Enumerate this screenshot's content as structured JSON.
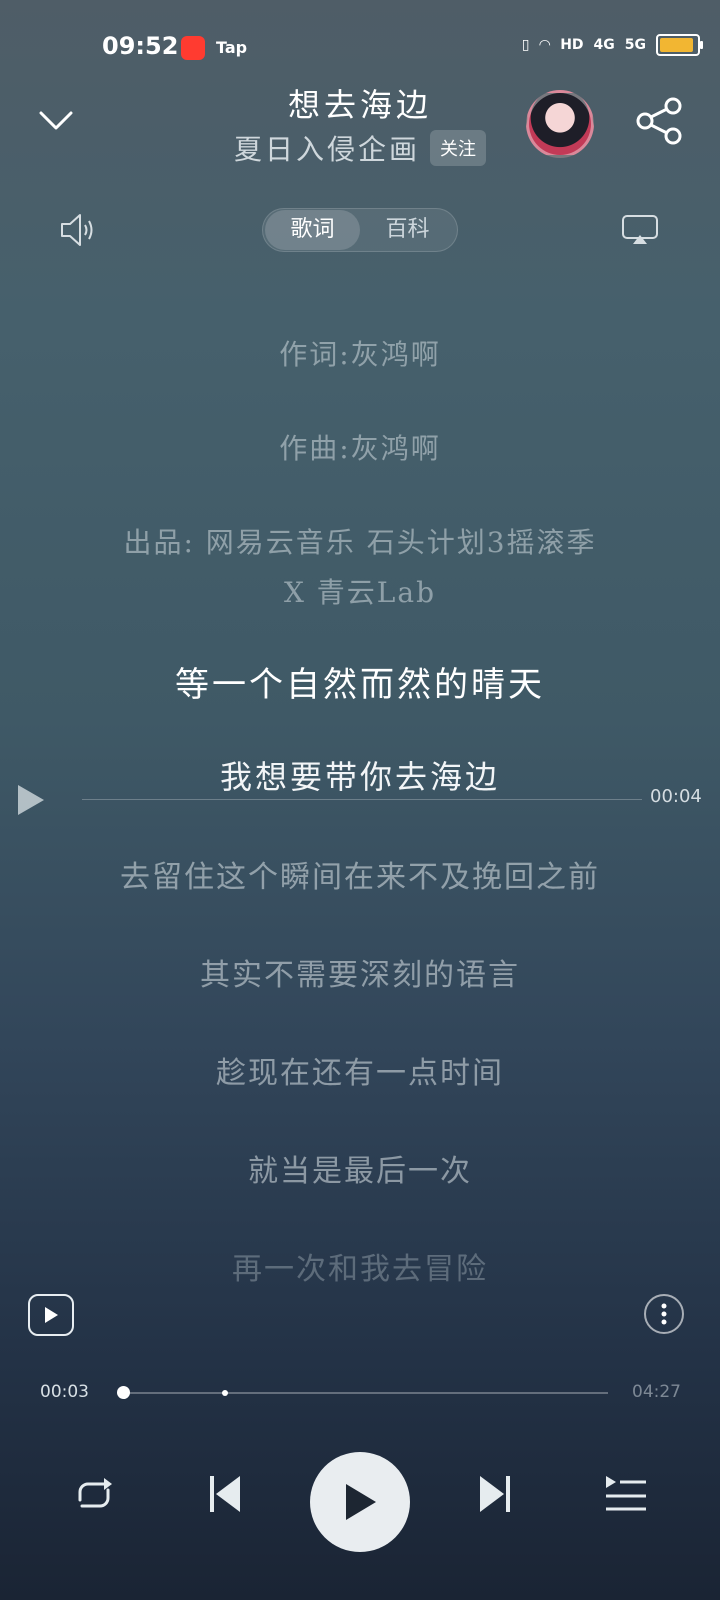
{
  "status_bar": {
    "time": "09:52",
    "app_label": "Tap",
    "network_labels": [
      "HD",
      "4G",
      "5G"
    ]
  },
  "header": {
    "title": "想去海边",
    "artist": "夏日入侵企画",
    "follow_label": "关注"
  },
  "tabs": [
    {
      "label": "歌词",
      "active": true
    },
    {
      "label": "百科",
      "active": false
    }
  ],
  "lyrics": {
    "credits": [
      "作词:灰鸿啊",
      "作曲:灰鸿啊",
      "出品: 网易云音乐 石头计划3摇滚季",
      "X 青云Lab"
    ],
    "current_line": "等一个自然而然的晴天",
    "seek_line": "我想要带你去海边",
    "upcoming": [
      "去留住这个瞬间在来不及挽回之前",
      "其实不需要深刻的语言",
      "趁现在还有一点时间",
      "就当是最后一次"
    ],
    "faded_line": "再一次和我去冒险",
    "seek_time": "00:04"
  },
  "progress": {
    "current": "00:03",
    "total": "04:27",
    "fraction": 0.012
  },
  "icons": {
    "collapse": "chevron-down-icon",
    "share": "share-icon",
    "volume": "volume-icon",
    "airplay": "airplay-icon",
    "repeat": "repeat-icon",
    "previous": "previous-icon",
    "play": "play-icon",
    "next": "next-icon",
    "playlist": "playlist-icon"
  },
  "colors": {
    "accent": "#ffffff",
    "battery": "#f2b632"
  }
}
